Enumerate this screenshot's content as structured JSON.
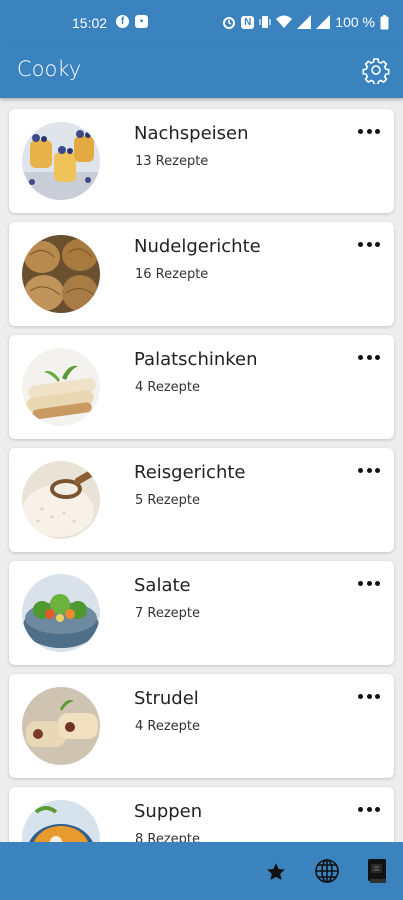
{
  "status_bar": {
    "time": "15:02",
    "battery": "100 %",
    "icons": [
      "f-notification-icon",
      "image-notification-icon",
      "alarm-icon",
      "nfc-icon",
      "vibrate-icon",
      "wifi-icon",
      "signal-icon",
      "signal-icon-2",
      "battery-icon"
    ]
  },
  "app_bar": {
    "title": "Cooky",
    "settings_icon": "gear-icon"
  },
  "categories": [
    {
      "name": "Nachspeisen",
      "count": "13 Rezepte"
    },
    {
      "name": "Nudelgerichte",
      "count": "16 Rezepte"
    },
    {
      "name": "Palatschinken",
      "count": "4 Rezepte"
    },
    {
      "name": "Reisgerichte",
      "count": "5 Rezepte"
    },
    {
      "name": "Salate",
      "count": "7 Rezepte"
    },
    {
      "name": "Strudel",
      "count": "4 Rezepte"
    },
    {
      "name": "Suppen",
      "count": "8 Rezepte"
    }
  ],
  "bottom_nav": {
    "icons": [
      "star-icon",
      "globe-icon",
      "book-icon"
    ]
  },
  "colors": {
    "primary": "#3a83bf",
    "background": "#ededed",
    "card": "#ffffff"
  }
}
